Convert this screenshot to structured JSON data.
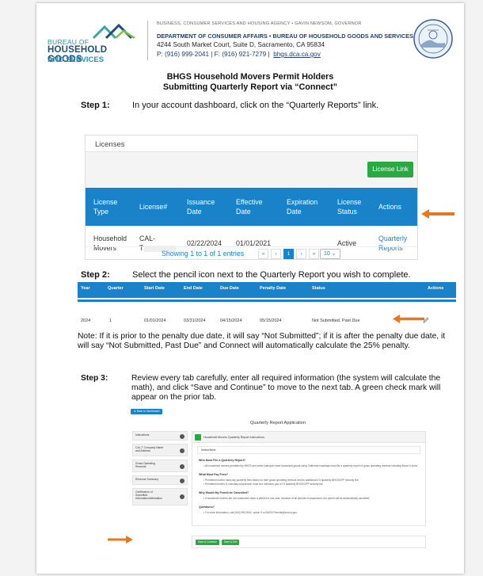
{
  "letterhead": {
    "logo_line1": "BUREAU OF",
    "logo_line2": "HOUSEHOLD GOODS",
    "logo_line3": "AND SERVICES",
    "agency": "BUSINESS, CONSUMER SERVICES AND HOUSING AGENCY  •  GAVIN NEWSOM, GOVERNOR",
    "department": "DEPARTMENT OF CONSUMER AFFAIRS • BUREAU OF HOUSEHOLD GOODS AND SERVICES",
    "address": "4244 South Market Court, Suite D, Sacramento, CA 95834",
    "phone": "P: (916) 999-2041   |   F: (916) 921-7279   |",
    "website": "bhgs.dca.ca.gov"
  },
  "title_line1": "BHGS Household Movers Permit Holders",
  "title_line2": "Submitting Quarterly Report via “Connect”",
  "step1": {
    "label": "Step 1:",
    "text": "In your account dashboard, click on the “Quarterly Reports” link."
  },
  "licenses": {
    "panel_title": "Licenses",
    "button": "License Link",
    "headers": [
      [
        "License",
        "Type"
      ],
      [
        "License#"
      ],
      [
        "Issuance",
        "Date"
      ],
      [
        "Effective",
        "Date"
      ],
      [
        "Expiration",
        "Date"
      ],
      [
        "License",
        "Status"
      ],
      [
        "Actions"
      ]
    ],
    "row": {
      "type_line1": "Household",
      "type_line2": "Movers",
      "license_line1": "CAL-",
      "license_line2": "T",
      "issuance": "02/22/2024",
      "effective": "01/01/2021",
      "expiration": "",
      "status": "Active",
      "action_line1": "Quarterly",
      "action_line2": "Reports"
    },
    "pager_info": "Showing 1 to 1 of 1 entries",
    "pager_buttons": [
      "«",
      "‹",
      "1",
      "›",
      "»"
    ],
    "page_size": "10"
  },
  "step2": {
    "label": "Step 2:",
    "text": "Select the pencil icon next to the Quarterly Report you wish to complete."
  },
  "quarterly": {
    "headers": [
      "Year",
      "Quarter",
      "Start Date",
      "End Date",
      "Due Date",
      "Penalty Date",
      "Status",
      "Actions"
    ],
    "row": [
      "2024",
      "1",
      "01/01/2024",
      "03/31/2024",
      "04/15/2024",
      "05/15/2024",
      "Not Submitted, Past Due"
    ]
  },
  "note": "Note: If it is prior to the penalty due date, it will say “Not Submitted”; if it is after the penalty due date, it will say “Not Submitted, Past Due” and Connect will automatically calculate the 25% penalty.",
  "step3": {
    "label": "Step 3:",
    "text": "Review every tab carefully, enter all required information (the system will calculate the math), and click “Save and Continue” to move to the next tab. A green check mark will appear on the prior tab."
  },
  "app": {
    "back_button": "◄ Back to Dashboard",
    "title": "Quarterly Report Application",
    "sidebar": [
      [
        "Instructions"
      ],
      [
        "CAL-T Company Name",
        "and Address"
      ],
      [
        "Gross Operating",
        "Revenue"
      ],
      [
        "Revenue Summary"
      ],
      [
        "Certification of",
        "Submitted",
        "Information/Attestation"
      ]
    ],
    "top_label": "Household Movers Quarterly Report Instructions",
    "instructions_label": "Instructions",
    "sections": [
      {
        "h": "Who Must File a Quarterly Report?",
        "b": [
          "• All household movers permitted by BHGS and which transport used household goods using California roadways must file a quarterly report of gross operating revenue including those in voluntary suspension."
        ]
      },
      {
        "h": "What Must Pay Fees?",
        "b": [
          "• Permitted movers must pay quarterly fees based on their gross operating revenue and an additional 0.5 quarterly BHGS/CPP security fee.",
          "• Permitted movers in voluntary suspension must at a minimum pay a 0.5 quarterly BHGS/CPP security fee."
        ]
      },
      {
        "h": "Why Would My Permit be Cancelled?",
        "b": [
          "• If household movers are not conducted under a permit for one year, inclusive of all periods of suspension, the permit will be automatically cancelled."
        ]
      },
      {
        "h": "Questions?",
        "b": [
          "• For more information, call (916) 999-2041, option 3 or BHGS.Permits@dca.ca.gov."
        ]
      }
    ],
    "save_button": "Save & Continue",
    "save_exit_button": "Save & Exit"
  },
  "colors": {
    "primary": "#1a82c8",
    "success": "#2aa844",
    "arrow": "#e87722",
    "brand_dark": "#1d4f7c"
  }
}
